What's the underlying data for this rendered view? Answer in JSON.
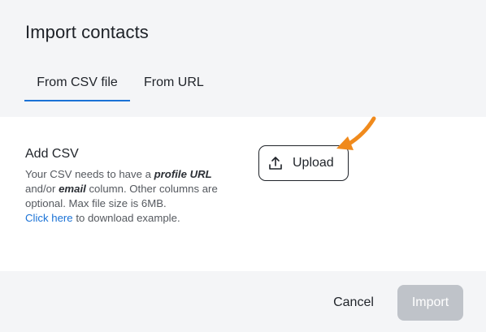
{
  "dialog": {
    "title": "Import contacts",
    "tabs": [
      {
        "label": "From CSV file",
        "active": true
      },
      {
        "label": "From URL",
        "active": false
      }
    ]
  },
  "csv_section": {
    "title": "Add CSV",
    "desc_part1": "Your CSV needs to have a ",
    "desc_bold1": "profile URL",
    "desc_part2": " and/or ",
    "desc_bold2": "email",
    "desc_part3": " column. Other columns are optional. Max file size is 6MB.",
    "link_text": "Click here",
    "after_link": " to download example.",
    "upload_label": "Upload"
  },
  "footer": {
    "cancel_label": "Cancel",
    "import_label": "Import"
  },
  "colors": {
    "accent": "#1a72d6",
    "annotation_arrow": "#f08a1c",
    "disabled_button": "#bfc3c9"
  },
  "icons": {
    "upload": "upload-icon",
    "annotation": "pointer-arrow-icon"
  }
}
